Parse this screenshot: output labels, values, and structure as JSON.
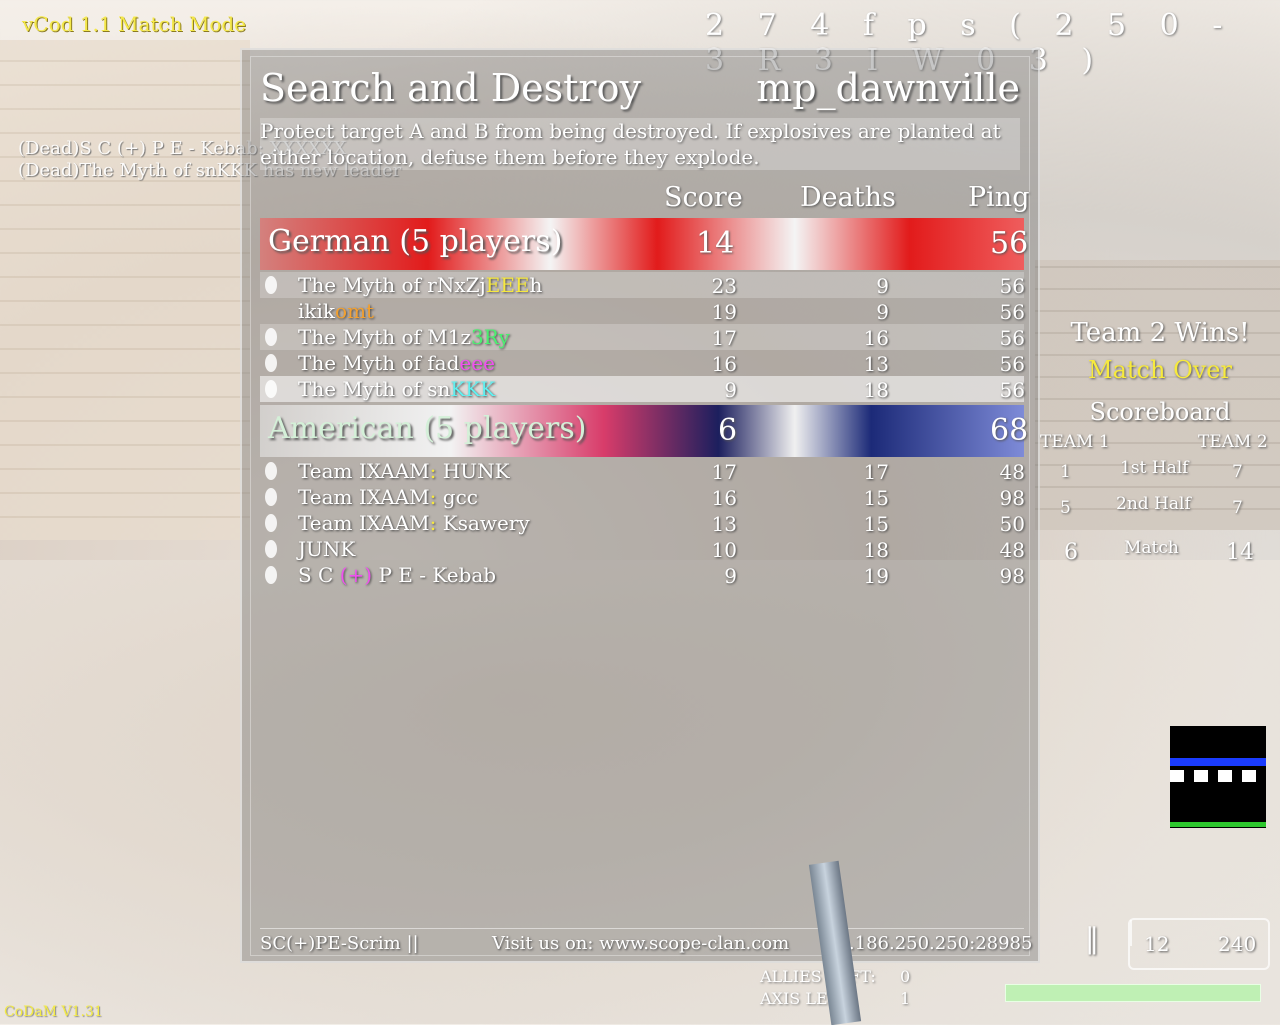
{
  "hud": {
    "mode": "vCod 1.1 Match Mode",
    "fps": "2 7 4 f p s ( 2 5 0 - 3 R 3 I W 0 3 )",
    "killfeed": [
      "(Dead)S C (+) P E - Kebab: XXXXXX",
      "(Dead)The Myth of snKKK  has new leader"
    ],
    "version": "CoDaM V1.31"
  },
  "scoreboard": {
    "gametype": "Search and Destroy",
    "map": "mp_dawnville",
    "objective": "Protect target A and B from being destroyed. If explosives are planted at either location, defuse them before they explode.",
    "columns": {
      "score": "Score",
      "deaths": "Deaths",
      "ping": "Ping"
    },
    "teams": [
      {
        "name": "German (5 players)",
        "score": "14",
        "ping": "56",
        "players": [
          {
            "pre": "The Myth of rNxZj",
            "tag": "EEE",
            "post": "h",
            "score": "23",
            "deaths": "9",
            "ping": "56"
          },
          {
            "pre": "ikik",
            "tag": "omt",
            "post": "",
            "score": "19",
            "deaths": "9",
            "ping": "56"
          },
          {
            "pre": "The Myth of M1z",
            "tag": "3Ry",
            "post": "",
            "score": "17",
            "deaths": "16",
            "ping": "56"
          },
          {
            "pre": "The Myth of fad",
            "tag": "eee",
            "post": "",
            "score": "16",
            "deaths": "13",
            "ping": "56"
          },
          {
            "pre": "The Myth of sn",
            "tag": "KKK",
            "post": "",
            "score": "9",
            "deaths": "18",
            "ping": "56"
          }
        ]
      },
      {
        "name": "American (5 players)",
        "score": "6",
        "ping": "68",
        "players": [
          {
            "pre": "Team IXAAM",
            "tag": ":",
            "post": " HUNK",
            "score": "17",
            "deaths": "17",
            "ping": "48"
          },
          {
            "pre": "Team IXAAM",
            "tag": ":",
            "post": " gcc",
            "score": "16",
            "deaths": "15",
            "ping": "98"
          },
          {
            "pre": "Team IXAAM",
            "tag": ":",
            "post": " Ksawery",
            "score": "13",
            "deaths": "15",
            "ping": "50"
          },
          {
            "pre": "JUNK",
            "tag": "",
            "post": "",
            "score": "10",
            "deaths": "18",
            "ping": "48"
          },
          {
            "pre": "S C ",
            "tag": "(+)",
            "post": " P E - Kebab",
            "score": "9",
            "deaths": "19",
            "ping": "98"
          }
        ]
      }
    ],
    "footer": {
      "server": "SC(+)PE-Scrim ||",
      "visit": "Visit us on: www.scope-clan.com",
      "ip": "31.186.250.250:28985"
    }
  },
  "match_summary": {
    "result": "Team 2 Wins!",
    "status": "Match Over",
    "title": "Scoreboard",
    "team1": "TEAM 1",
    "team2": "TEAM 2",
    "rows": [
      {
        "label": "1st Half",
        "t1": "1",
        "t2": "7"
      },
      {
        "label": "2nd Half",
        "t1": "5",
        "t2": "7"
      },
      {
        "label": "Match",
        "t1": "6",
        "t2": "14"
      }
    ]
  },
  "ammo": {
    "clip": "12",
    "reserve": "240"
  },
  "status": {
    "allies_label": "ALLIES LEFT:",
    "allies": "0",
    "axis_label": "AXIS LEFT:",
    "axis": "1"
  },
  "health_fraction": 1.0,
  "colors": {
    "hud_yellow": "#f4e84a",
    "german_red": "#e21b1b",
    "american_blue": "#1c2a78",
    "health_green": "#bff0b4"
  }
}
